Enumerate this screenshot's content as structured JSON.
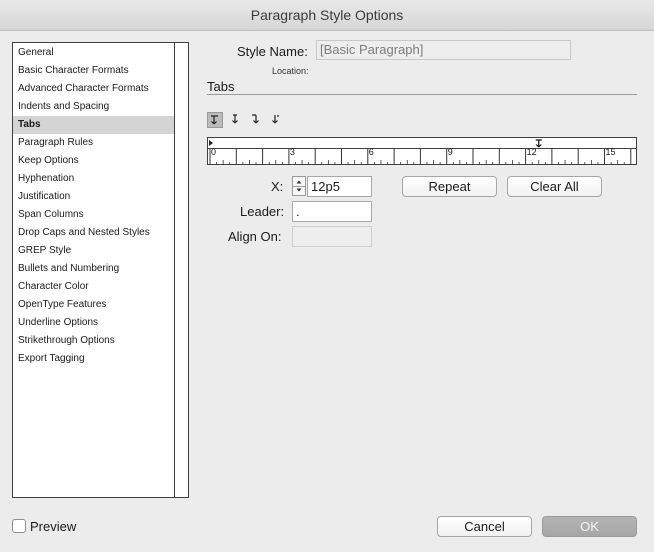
{
  "window": {
    "title": "Paragraph Style Options"
  },
  "sidebar": {
    "selected": "Tabs",
    "items": [
      "General",
      "Basic Character Formats",
      "Advanced Character Formats",
      "Indents and Spacing",
      "Tabs",
      "Paragraph Rules",
      "Keep Options",
      "Hyphenation",
      "Justification",
      "Span Columns",
      "Drop Caps and Nested Styles",
      "GREP Style",
      "Bullets and Numbering",
      "Character Color",
      "OpenType Features",
      "Underline Options",
      "Strikethrough Options",
      "Export Tagging"
    ]
  },
  "header": {
    "style_name_label": "Style Name:",
    "style_name_value": "[Basic Paragraph]",
    "location_label": "Location:"
  },
  "tabs_panel": {
    "section_title": "Tabs",
    "tab_types": [
      "left-justified-tab-icon",
      "center-justified-tab-icon",
      "right-justified-tab-icon",
      "align-to-decimal-tab-icon"
    ],
    "active_tab_type": "left-justified-tab-icon",
    "ruler": {
      "labels": [
        "0",
        "3",
        "6",
        "9",
        "12",
        "15"
      ],
      "tab_stop_position": 12.5
    },
    "x_label": "X:",
    "x_value": "12p5",
    "leader_label": "Leader:",
    "leader_value": ".",
    "align_on_label": "Align On:",
    "align_on_value": "",
    "repeat_label": "Repeat",
    "clear_all_label": "Clear All"
  },
  "footer": {
    "preview_label": "Preview",
    "preview_checked": false,
    "cancel_label": "Cancel",
    "ok_label": "OK"
  }
}
